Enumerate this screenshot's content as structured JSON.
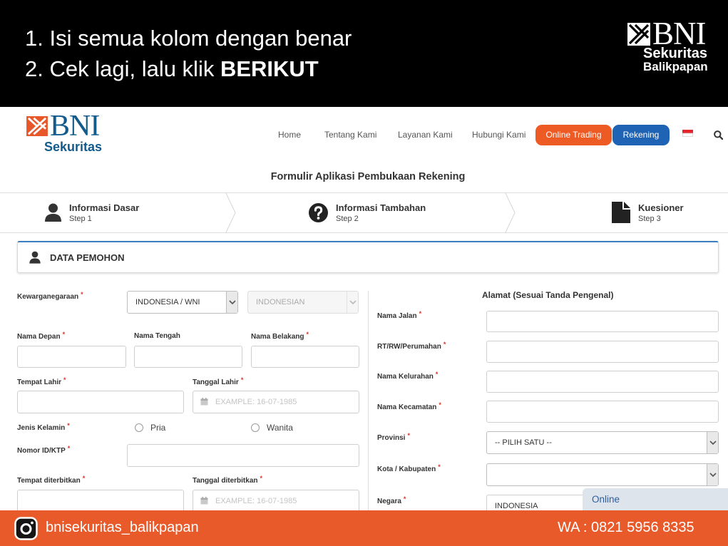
{
  "banner": {
    "instruction_1": "1. Isi semua kolom dengan benar",
    "instruction_2_text": "2. Cek lagi, lalu klik ",
    "instruction_2_bold": "BERIKUT",
    "logo_brand": "BNI",
    "logo_sub": "Sekuritas",
    "logo_city": "Balikpapan"
  },
  "site": {
    "logo_brand": "BNI",
    "logo_sub": "Sekuritas",
    "nav": [
      "Home",
      "Tentang Kami",
      "Layanan Kami",
      "Hubungi Kami"
    ],
    "online_trading_label": "Online Trading",
    "rekening_label": "Rekening",
    "language_icon": "indonesia-flag-icon",
    "search_icon": "search-icon",
    "page_title": "Formulir Aplikasi Pembukaan Rekening",
    "steps": [
      {
        "icon": "user-icon",
        "name": "Informasi Dasar",
        "sub": "Step 1"
      },
      {
        "icon": "question-circle-icon",
        "name": "Informasi Tambahan",
        "sub": "Step 2"
      },
      {
        "icon": "document-icon",
        "name": "Kuesioner",
        "sub": "Step 3"
      }
    ],
    "panel_title": "DATA PEMOHON"
  },
  "form": {
    "required_mark": "*",
    "left": {
      "kewarganegaraan": {
        "label": "Kewarganegaraan",
        "value": "INDONESIA / WNI",
        "nationality_value": "INDONESIAN"
      },
      "nama_depan": {
        "label": "Nama Depan",
        "value": ""
      },
      "nama_tengah": {
        "label": "Nama Tengah",
        "value": ""
      },
      "nama_belakang": {
        "label": "Nama Belakang",
        "value": ""
      },
      "tempat_lahir": {
        "label": "Tempat Lahir",
        "value": ""
      },
      "tanggal_lahir": {
        "label": "Tanggal Lahir",
        "placeholder": "EXAMPLE: 16-07-1985"
      },
      "jenis_kelamin": {
        "label": "Jenis Kelamin",
        "options": [
          "Pria",
          "Wanita"
        ]
      },
      "nomor_id": {
        "label": "Nomor ID/KTP",
        "value": ""
      },
      "tempat_diterbitkan": {
        "label": "Tempat diterbitkan",
        "value": ""
      },
      "tanggal_diterbitkan": {
        "label": "Tanggal diterbitkan",
        "placeholder": "EXAMPLE: 16-07-1985"
      }
    },
    "right": {
      "title": "Alamat (Sesuai Tanda Pengenal)",
      "nama_jalan": {
        "label": "Nama Jalan",
        "value": ""
      },
      "rt_rw": {
        "label": "RT/RW/Perumahan",
        "value": ""
      },
      "kelurahan": {
        "label": "Nama Kelurahan",
        "value": ""
      },
      "kecamatan": {
        "label": "Nama Kecamatan",
        "value": ""
      },
      "provinsi": {
        "label": "Provinsi",
        "value": "-- PILIH SATU --"
      },
      "kota": {
        "label": "Kota / Kabupaten",
        "value": ""
      },
      "negara": {
        "label": "Negara",
        "value": "INDONESIA"
      }
    }
  },
  "chat": {
    "status": "Online"
  },
  "footer": {
    "instagram_handle": "bnisekuritas_balikpapan",
    "whatsapp": "WA : 0821 5956 8335"
  },
  "colors": {
    "banner_bg": "#000000",
    "footer_orange": "#e95a2b",
    "online_trading_orange": "#ee5a24",
    "rekening_blue": "#1f63b5",
    "brand_blue": "#125b8c",
    "required_red": "#d9342b"
  }
}
